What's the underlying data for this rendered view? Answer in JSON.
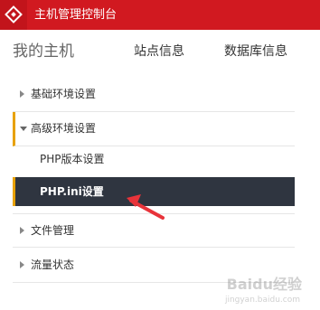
{
  "header": {
    "title": "主机管理控制台",
    "logo_icon": "diamond-logo-icon"
  },
  "navbar": {
    "brand": "我的主机",
    "links": [
      "站点信息",
      "数据库信息"
    ]
  },
  "sidebar": {
    "sections": [
      {
        "label": "基础环境设置",
        "expanded": false
      },
      {
        "label": "高级环境设置",
        "expanded": true
      },
      {
        "label": "文件管理",
        "expanded": false
      },
      {
        "label": "流量状态",
        "expanded": false
      }
    ],
    "sub_items": [
      {
        "label": "PHP版本设置",
        "selected": false
      },
      {
        "label": "PHP.ini设置",
        "selected": true
      }
    ]
  },
  "watermark": {
    "text": "Baidu经验",
    "url": "jingyan.baidu.com"
  },
  "colors": {
    "topbar": "#d11920",
    "accent": "#e8a100",
    "selected_bg": "#2f3540",
    "pointer_arrow": "#e8333a"
  }
}
